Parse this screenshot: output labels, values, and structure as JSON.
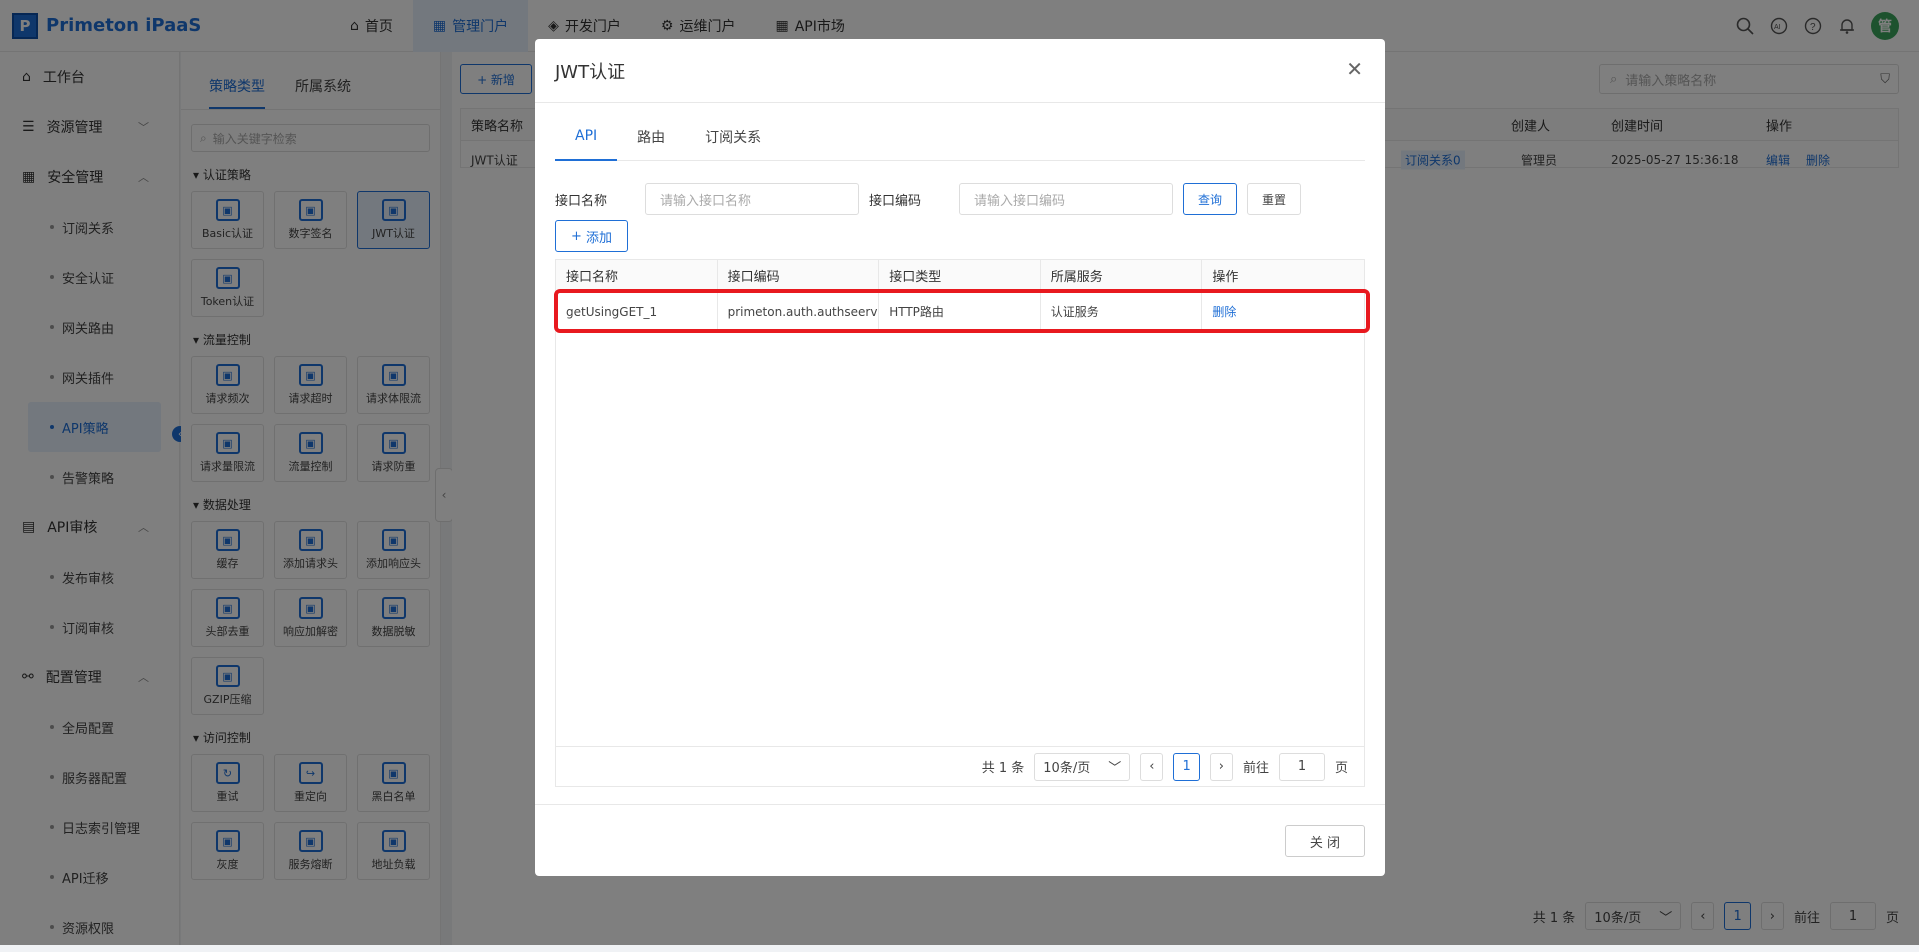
{
  "app": {
    "logo_letter": "P",
    "name": "Primeton iPaaS"
  },
  "topnav": [
    {
      "label": "首页",
      "icon": "home-icon"
    },
    {
      "label": "管理门户",
      "icon": "grid-icon",
      "active": true
    },
    {
      "label": "开发门户",
      "icon": "layers-icon"
    },
    {
      "label": "运维门户",
      "icon": "ops-icon"
    },
    {
      "label": "API市场",
      "icon": "grid-icon"
    }
  ],
  "user": {
    "avatar_text": "管"
  },
  "sidebar": {
    "workbench": "工作台",
    "resource_mgmt": "资源管理",
    "security_mgmt": "安全管理",
    "security_items": [
      "订阅关系",
      "安全认证",
      "网关路由",
      "网关插件",
      "API策略",
      "告警策略"
    ],
    "api_review": "API审核",
    "review_items": [
      "发布审核",
      "订阅审核"
    ],
    "config_mgmt": "配置管理",
    "config_items": [
      "全局配置",
      "服务器配置",
      "日志索引管理",
      "API迁移",
      "资源权限"
    ]
  },
  "policy_panel": {
    "tabs": [
      "策略类型",
      "所属系统"
    ],
    "search_placeholder": "输入关键字检索",
    "sections": [
      {
        "title": "认证策略",
        "items": [
          "Basic认证",
          "数字签名",
          "JWT认证",
          "Token认证"
        ]
      },
      {
        "title": "流量控制",
        "items": [
          "请求频次",
          "请求超时",
          "请求体限流",
          "请求量限流",
          "流量控制",
          "请求防重"
        ]
      },
      {
        "title": "数据处理",
        "items": [
          "缓存",
          "添加请求头",
          "添加响应头",
          "头部去重",
          "响应加解密",
          "数据脱敏",
          "GZIP压缩"
        ]
      },
      {
        "title": "访问控制",
        "items": [
          "重试",
          "重定向",
          "黑白名单",
          "灰度",
          "服务熔断",
          "地址负载"
        ]
      }
    ]
  },
  "main": {
    "new_label": "+ 新增",
    "search_placeholder": "请输入策略名称",
    "headers": {
      "name": "策略名称",
      "creator": "创建人",
      "created": "创建时间",
      "actions": "操作"
    },
    "row": {
      "name": "JWT认证",
      "subscription": "订阅关系0",
      "creator": "管理员",
      "created": "2025-05-27 15:36:18",
      "edit": "编辑",
      "delete": "删除"
    },
    "pager": {
      "total": "共 1 条",
      "size": "10条/页",
      "page": "1",
      "goto": "前往",
      "goto_val": "1",
      "page_unit": "页"
    }
  },
  "modal": {
    "title": "JWT认证",
    "tabs": [
      "API",
      "路由",
      "订阅关系"
    ],
    "filter": {
      "name_label": "接口名称",
      "name_placeholder": "请输入接口名称",
      "code_label": "接口编码",
      "code_placeholder": "请输入接口编码",
      "query": "查询",
      "reset": "重置"
    },
    "add_label": "添加",
    "table": {
      "headers": [
        "接口名称",
        "接口编码",
        "接口类型",
        "所属服务",
        "操作"
      ],
      "rows": [
        {
          "name": "getUsingGET_1",
          "code": "primeton.auth.authseervi...",
          "type": "HTTP路由",
          "service": "认证服务",
          "action": "删除"
        }
      ]
    },
    "pager": {
      "total": "共 1 条",
      "size": "10条/页",
      "page": "1",
      "goto": "前往",
      "goto_val": "1",
      "page_unit": "页"
    },
    "close_label": "关 闭"
  },
  "colors": {
    "accent": "#1f6fd6",
    "highlight": "#e8191f"
  }
}
